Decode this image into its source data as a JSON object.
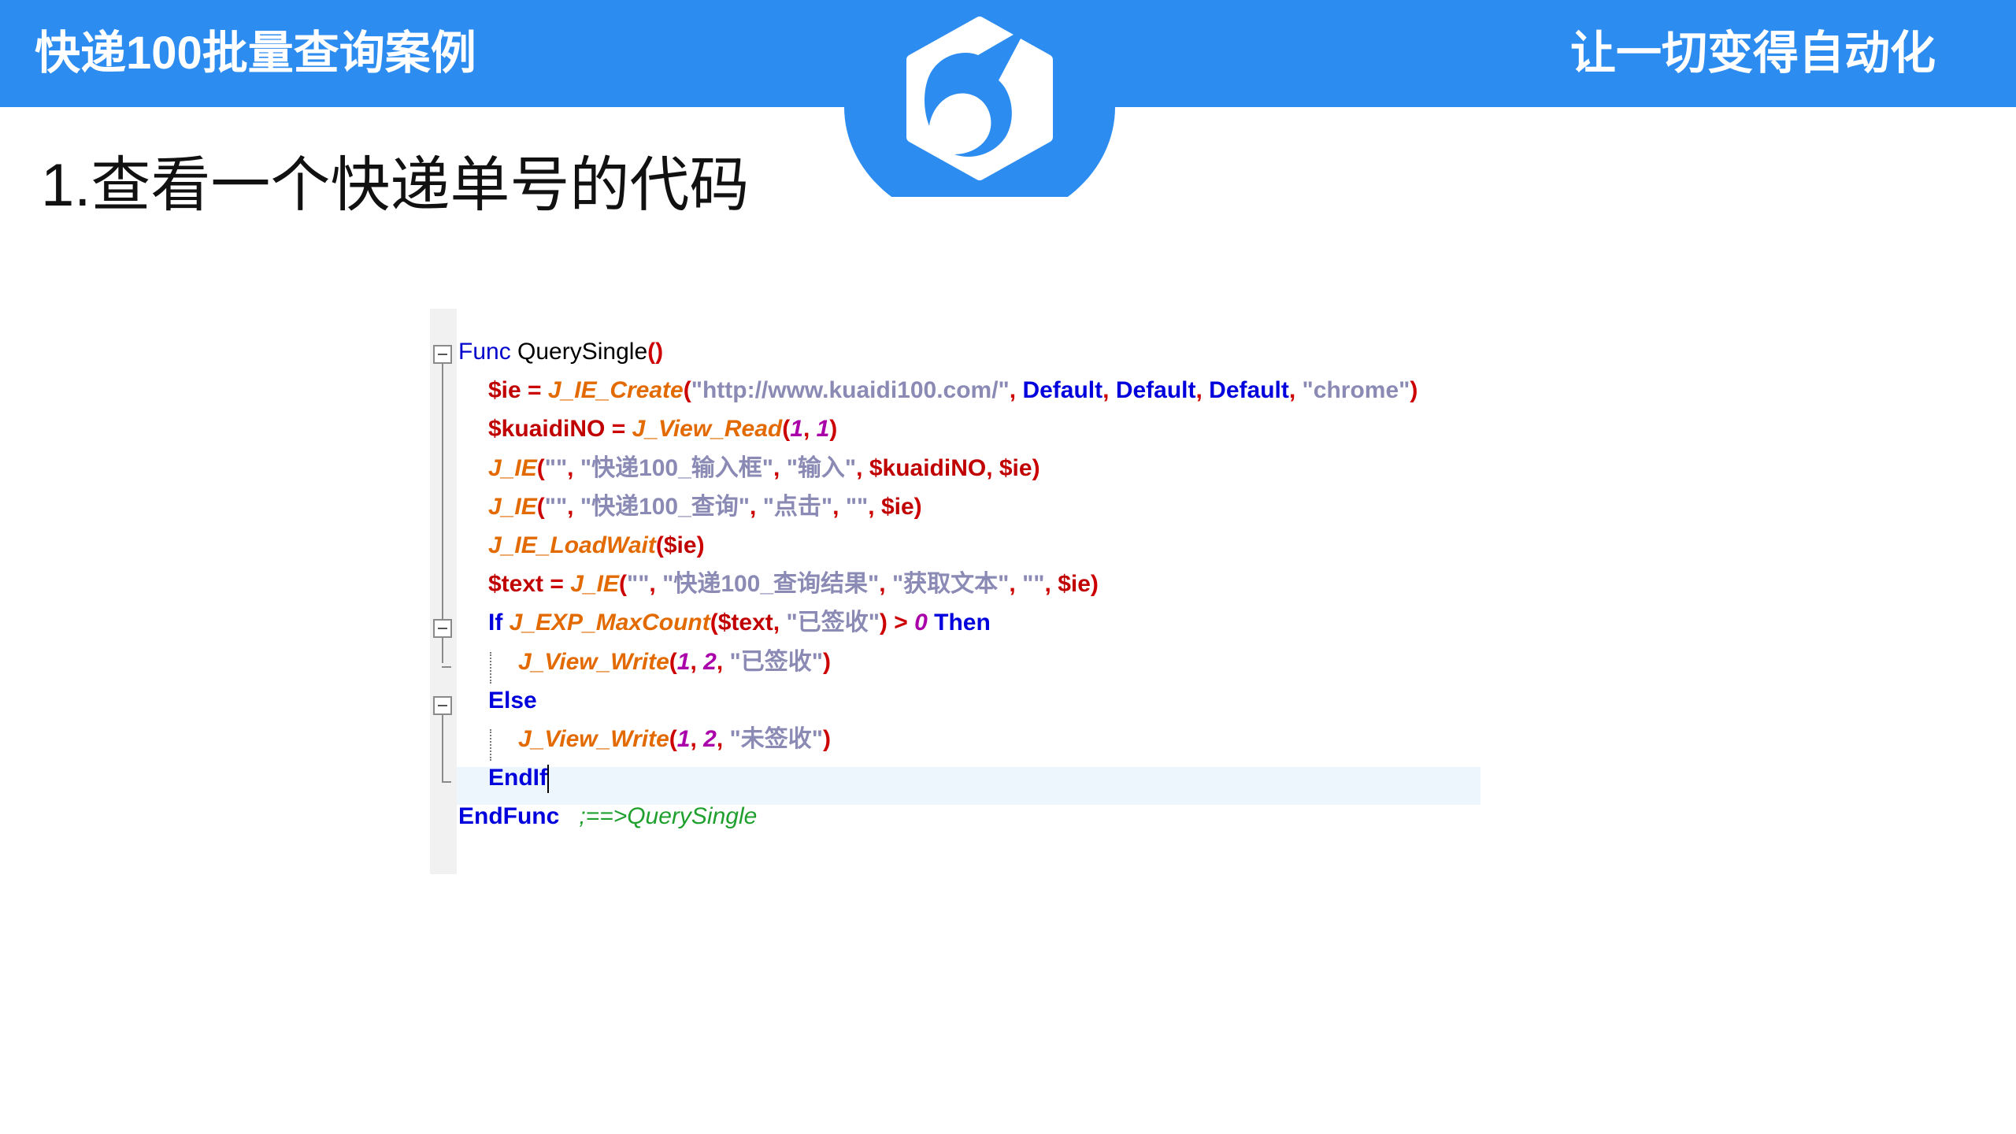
{
  "header": {
    "title": "快递100批量查询案例",
    "slogan": "让一切变得自动化",
    "brand_color": "#2d8cf0",
    "logo_icon": "unicorn-logo-icon"
  },
  "subtitle": "1.查看一个快递单号的代码",
  "code": {
    "lines": [
      {
        "tokens": [
          {
            "t": "Func",
            "c": "kwn"
          },
          {
            "t": " QuerySingle",
            "c": "plain"
          },
          {
            "t": "()",
            "c": "op"
          }
        ]
      },
      {
        "tokens": [
          {
            "t": "$ie",
            "c": "var"
          },
          {
            "t": " = ",
            "c": "op"
          },
          {
            "t": "J_IE_Create",
            "c": "fn"
          },
          {
            "t": "(",
            "c": "op"
          },
          {
            "t": "\"http://www.kuaidi100.com/\"",
            "c": "str"
          },
          {
            "t": ", ",
            "c": "op"
          },
          {
            "t": "Default",
            "c": "kw"
          },
          {
            "t": ", ",
            "c": "op"
          },
          {
            "t": "Default",
            "c": "kw"
          },
          {
            "t": ", ",
            "c": "op"
          },
          {
            "t": "Default",
            "c": "kw"
          },
          {
            "t": ", ",
            "c": "op"
          },
          {
            "t": "\"chrome\"",
            "c": "str"
          },
          {
            "t": ")",
            "c": "op"
          }
        ]
      },
      {
        "tokens": [
          {
            "t": "$kuaidiNO",
            "c": "var"
          },
          {
            "t": " = ",
            "c": "op"
          },
          {
            "t": "J_View_Read",
            "c": "fn"
          },
          {
            "t": "(",
            "c": "op"
          },
          {
            "t": "1",
            "c": "num"
          },
          {
            "t": ", ",
            "c": "op"
          },
          {
            "t": "1",
            "c": "num"
          },
          {
            "t": ")",
            "c": "op"
          }
        ]
      },
      {
        "tokens": [
          {
            "t": "J_IE",
            "c": "fn"
          },
          {
            "t": "(",
            "c": "op"
          },
          {
            "t": "\"\"",
            "c": "str"
          },
          {
            "t": ", ",
            "c": "op"
          },
          {
            "t": "\"快递100_输入框\"",
            "c": "str"
          },
          {
            "t": ", ",
            "c": "op"
          },
          {
            "t": "\"输入\"",
            "c": "str"
          },
          {
            "t": ", ",
            "c": "op"
          },
          {
            "t": "$kuaidiNO",
            "c": "var"
          },
          {
            "t": ", ",
            "c": "op"
          },
          {
            "t": "$ie",
            "c": "var"
          },
          {
            "t": ")",
            "c": "op"
          }
        ]
      },
      {
        "tokens": [
          {
            "t": "J_IE",
            "c": "fn"
          },
          {
            "t": "(",
            "c": "op"
          },
          {
            "t": "\"\"",
            "c": "str"
          },
          {
            "t": ", ",
            "c": "op"
          },
          {
            "t": "\"快递100_查询\"",
            "c": "str"
          },
          {
            "t": ", ",
            "c": "op"
          },
          {
            "t": "\"点击\"",
            "c": "str"
          },
          {
            "t": ", ",
            "c": "op"
          },
          {
            "t": "\"\"",
            "c": "str"
          },
          {
            "t": ", ",
            "c": "op"
          },
          {
            "t": "$ie",
            "c": "var"
          },
          {
            "t": ")",
            "c": "op"
          }
        ]
      },
      {
        "tokens": [
          {
            "t": "J_IE_LoadWait",
            "c": "fn"
          },
          {
            "t": "(",
            "c": "op"
          },
          {
            "t": "$ie",
            "c": "var"
          },
          {
            "t": ")",
            "c": "op"
          }
        ]
      },
      {
        "tokens": [
          {
            "t": "$text",
            "c": "var"
          },
          {
            "t": " = ",
            "c": "op"
          },
          {
            "t": "J_IE",
            "c": "fn"
          },
          {
            "t": "(",
            "c": "op"
          },
          {
            "t": "\"\"",
            "c": "str"
          },
          {
            "t": ", ",
            "c": "op"
          },
          {
            "t": "\"快递100_查询结果\"",
            "c": "str"
          },
          {
            "t": ", ",
            "c": "op"
          },
          {
            "t": "\"获取文本\"",
            "c": "str"
          },
          {
            "t": ", ",
            "c": "op"
          },
          {
            "t": "\"\"",
            "c": "str"
          },
          {
            "t": ", ",
            "c": "op"
          },
          {
            "t": "$ie",
            "c": "var"
          },
          {
            "t": ")",
            "c": "op"
          }
        ]
      },
      {
        "tokens": [
          {
            "t": "If ",
            "c": "kw"
          },
          {
            "t": "J_EXP_MaxCount",
            "c": "fn"
          },
          {
            "t": "(",
            "c": "op"
          },
          {
            "t": "$text",
            "c": "var"
          },
          {
            "t": ", ",
            "c": "op"
          },
          {
            "t": "\"已签收\"",
            "c": "str"
          },
          {
            "t": ") > ",
            "c": "op"
          },
          {
            "t": "0",
            "c": "num"
          },
          {
            "t": " Then",
            "c": "kw"
          }
        ]
      },
      {
        "tokens": [
          {
            "t": "J_View_Write",
            "c": "fn"
          },
          {
            "t": "(",
            "c": "op"
          },
          {
            "t": "1",
            "c": "num"
          },
          {
            "t": ", ",
            "c": "op"
          },
          {
            "t": "2",
            "c": "num"
          },
          {
            "t": ", ",
            "c": "op"
          },
          {
            "t": "\"已签收\"",
            "c": "str"
          },
          {
            "t": ")",
            "c": "op"
          }
        ]
      },
      {
        "tokens": [
          {
            "t": "Else",
            "c": "kw"
          }
        ]
      },
      {
        "tokens": [
          {
            "t": "J_View_Write",
            "c": "fn"
          },
          {
            "t": "(",
            "c": "op"
          },
          {
            "t": "1",
            "c": "num"
          },
          {
            "t": ", ",
            "c": "op"
          },
          {
            "t": "2",
            "c": "num"
          },
          {
            "t": ", ",
            "c": "op"
          },
          {
            "t": "\"未签收\"",
            "c": "str"
          },
          {
            "t": ")",
            "c": "op"
          }
        ]
      },
      {
        "tokens": [
          {
            "t": "EndIf",
            "c": "kw"
          }
        ]
      },
      {
        "tokens": [
          {
            "t": "EndFunc",
            "c": "kw"
          },
          {
            "t": "   ;==>QuerySingle",
            "c": "cmt"
          }
        ]
      }
    ]
  }
}
